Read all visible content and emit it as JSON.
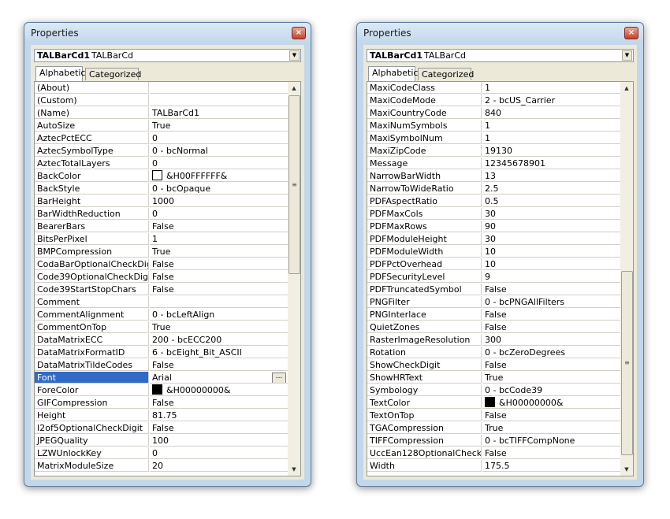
{
  "left": {
    "title": "Properties",
    "object_name": "TALBarCd1",
    "object_type": "TALBarCd",
    "tabs": [
      "Alphabetic",
      "Categorized"
    ],
    "rows": [
      {
        "name": "(About)",
        "value": ""
      },
      {
        "name": "(Custom)",
        "value": ""
      },
      {
        "name": "(Name)",
        "value": "TALBarCd1"
      },
      {
        "name": "AutoSize",
        "value": "True"
      },
      {
        "name": "AztecPctECC",
        "value": "0"
      },
      {
        "name": "AztecSymbolType",
        "value": "0 - bcNormal"
      },
      {
        "name": "AztecTotalLayers",
        "value": "0"
      },
      {
        "name": "BackColor",
        "value": "&H00FFFFFF&",
        "swatch": "#ffffff"
      },
      {
        "name": "BackStyle",
        "value": "0 - bcOpaque"
      },
      {
        "name": "BarHeight",
        "value": "1000"
      },
      {
        "name": "BarWidthReduction",
        "value": "0"
      },
      {
        "name": "BearerBars",
        "value": "False"
      },
      {
        "name": "BitsPerPixel",
        "value": "1"
      },
      {
        "name": "BMPCompression",
        "value": "True"
      },
      {
        "name": "CodaBarOptionalCheckDigit",
        "value": "False"
      },
      {
        "name": "Code39OptionalCheckDigit",
        "value": "False"
      },
      {
        "name": "Code39StartStopChars",
        "value": "False"
      },
      {
        "name": "Comment",
        "value": ""
      },
      {
        "name": "CommentAlignment",
        "value": "0 - bcLeftAlign"
      },
      {
        "name": "CommentOnTop",
        "value": "True"
      },
      {
        "name": "DataMatrixECC",
        "value": "200 - bcECC200"
      },
      {
        "name": "DataMatrixFormatID",
        "value": "6 - bcEight_Bit_ASCII"
      },
      {
        "name": "DataMatrixTildeCodes",
        "value": "False"
      },
      {
        "name": "Font",
        "value": "Arial",
        "selected": true,
        "button": "..."
      },
      {
        "name": "ForeColor",
        "value": "&H00000000&",
        "swatch": "#000000"
      },
      {
        "name": "GIFCompression",
        "value": "False"
      },
      {
        "name": "Height",
        "value": "81.75"
      },
      {
        "name": "I2of5OptionalCheckDigit",
        "value": "False"
      },
      {
        "name": "JPEGQuality",
        "value": "100"
      },
      {
        "name": "LZWUnlockKey",
        "value": "0"
      },
      {
        "name": "MatrixModuleSize",
        "value": "20"
      }
    ]
  },
  "right": {
    "title": "Properties",
    "object_name": "TALBarCd1",
    "object_type": "TALBarCd",
    "tabs": [
      "Alphabetic",
      "Categorized"
    ],
    "rows": [
      {
        "name": "MaxiCodeClass",
        "value": "1"
      },
      {
        "name": "MaxiCodeMode",
        "value": "2 - bcUS_Carrier"
      },
      {
        "name": "MaxiCountryCode",
        "value": "840"
      },
      {
        "name": "MaxiNumSymbols",
        "value": "1"
      },
      {
        "name": "MaxiSymbolNum",
        "value": "1"
      },
      {
        "name": "MaxiZipCode",
        "value": "19130"
      },
      {
        "name": "Message",
        "value": "12345678901"
      },
      {
        "name": "NarrowBarWidth",
        "value": "13"
      },
      {
        "name": "NarrowToWideRatio",
        "value": "2.5"
      },
      {
        "name": "PDFAspectRatio",
        "value": "0.5"
      },
      {
        "name": "PDFMaxCols",
        "value": "30"
      },
      {
        "name": "PDFMaxRows",
        "value": "90"
      },
      {
        "name": "PDFModuleHeight",
        "value": "30"
      },
      {
        "name": "PDFModuleWidth",
        "value": "10"
      },
      {
        "name": "PDFPctOverhead",
        "value": "10"
      },
      {
        "name": "PDFSecurityLevel",
        "value": "9"
      },
      {
        "name": "PDFTruncatedSymbol",
        "value": "False"
      },
      {
        "name": "PNGFilter",
        "value": "0 - bcPNGAllFilters"
      },
      {
        "name": "PNGInterlace",
        "value": "False"
      },
      {
        "name": "QuietZones",
        "value": "False"
      },
      {
        "name": "RasterImageResolution",
        "value": "300"
      },
      {
        "name": "Rotation",
        "value": "0 - bcZeroDegrees"
      },
      {
        "name": "ShowCheckDigit",
        "value": "False"
      },
      {
        "name": "ShowHRText",
        "value": "True"
      },
      {
        "name": "Symbology",
        "value": "0 - bcCode39"
      },
      {
        "name": "TextColor",
        "value": "&H00000000&",
        "swatch": "#000000"
      },
      {
        "name": "TextOnTop",
        "value": "False"
      },
      {
        "name": "TGACompression",
        "value": "True"
      },
      {
        "name": "TIFFCompression",
        "value": "0 - bcTIFFCompNone"
      },
      {
        "name": "UccEan128OptionalCheckDigit",
        "value": "False"
      },
      {
        "name": "Width",
        "value": "175.5"
      }
    ]
  },
  "icons": {
    "close": "close-icon",
    "dropdown": "chevron-down-icon",
    "scroll_up": "scroll-up-arrow-icon",
    "scroll_down": "scroll-down-arrow-icon"
  }
}
